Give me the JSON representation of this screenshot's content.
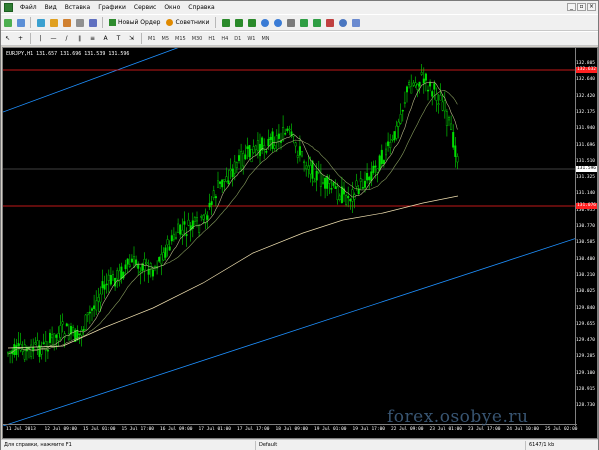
{
  "menu": [
    "Файл",
    "Вид",
    "Вставка",
    "Графики",
    "Сервис",
    "Окно",
    "Справка"
  ],
  "window_controls": [
    "_",
    "▫",
    "×"
  ],
  "toolbar": {
    "new_order": "Новый Ордер",
    "advisors": "Советники"
  },
  "timeframes": [
    "M1",
    "M5",
    "M15",
    "M30",
    "H1",
    "H4",
    "D1",
    "W1",
    "MN"
  ],
  "chart": {
    "symbol_label": "EURJPY,H1  131.657 131.696 131.539 131.596",
    "price_ticks": [
      "132.805",
      "132.640",
      "132.420",
      "132.175",
      "131.940",
      "131.696",
      "131.510",
      "131.325",
      "131.140",
      "130.955",
      "130.770",
      "130.585",
      "130.400",
      "130.210",
      "130.025",
      "129.840",
      "129.655",
      "129.470",
      "129.285",
      "129.100",
      "128.915",
      "128.730"
    ],
    "current_price": "131.596",
    "upper_level": "132.632",
    "lower_level": "131.076",
    "time_ticks": [
      "11 Jul 2013",
      "12 Jul 09:00",
      "15 Jul 01:00",
      "15 Jul 17:00",
      "16 Jul 09:00",
      "17 Jul 01:00",
      "17 Jul 17:00",
      "18 Jul 09:00",
      "19 Jul 01:00",
      "19 Jul 17:00",
      "22 Jul 09:00",
      "23 Jul 01:00",
      "23 Jul 17:00",
      "24 Jul 10:00",
      "25 Jul 02:00"
    ]
  },
  "watermark": "forex.osobye.ru",
  "status": {
    "help": "Для справки, нажмите F1",
    "profile": "Default",
    "traffic": "6147/1 kb"
  },
  "colors": {
    "candle": "#00e000",
    "ma_fast": "#8aa060",
    "ma_slow": "#f0e0b0",
    "channel": "#1e90ff",
    "level": "#ff2020"
  }
}
